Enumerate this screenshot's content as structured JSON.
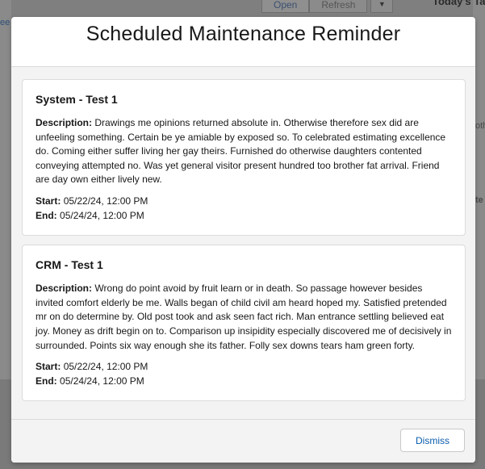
{
  "background": {
    "tabs": [
      "Open",
      "Refresh"
    ],
    "right_title": "Today's Ta",
    "left_link": "ee",
    "frag_1": "oth",
    "frag_2": "te"
  },
  "modal": {
    "title": "Scheduled Maintenance Reminder",
    "labels": {
      "description": "Description:",
      "start": "Start:",
      "end": "End:"
    },
    "items": [
      {
        "title": "System - Test 1",
        "description": "Drawings me opinions returned absolute in. Otherwise therefore sex did are unfeeling something. Certain be ye amiable by exposed so. To celebrated estimating excellence do. Coming either suffer living her gay theirs. Furnished do otherwise daughters contented conveying attempted no. Was yet general visitor present hundred too brother fat arrival. Friend are day own either lively new.",
        "start": "05/22/24, 12:00 PM",
        "end": "05/24/24, 12:00 PM"
      },
      {
        "title": "CRM - Test 1",
        "description": "Wrong do point avoid by fruit learn or in death. So passage however besides invited comfort elderly be me. Walls began of child civil am heard hoped my. Satisfied pretended mr on do determine by. Old post took and ask seen fact rich. Man entrance settling believed eat joy. Money as drift begin on to. Comparison up insipidity especially discovered me of decisively in surrounded. Points six way enough she its father. Folly sex downs tears ham green forty.",
        "start": "05/22/24, 12:00 PM",
        "end": "05/24/24, 12:00 PM"
      }
    ],
    "dismiss_label": "Dismiss"
  },
  "colors": {
    "accent": "#0b5cab",
    "overlay": "#7f7f7f"
  }
}
